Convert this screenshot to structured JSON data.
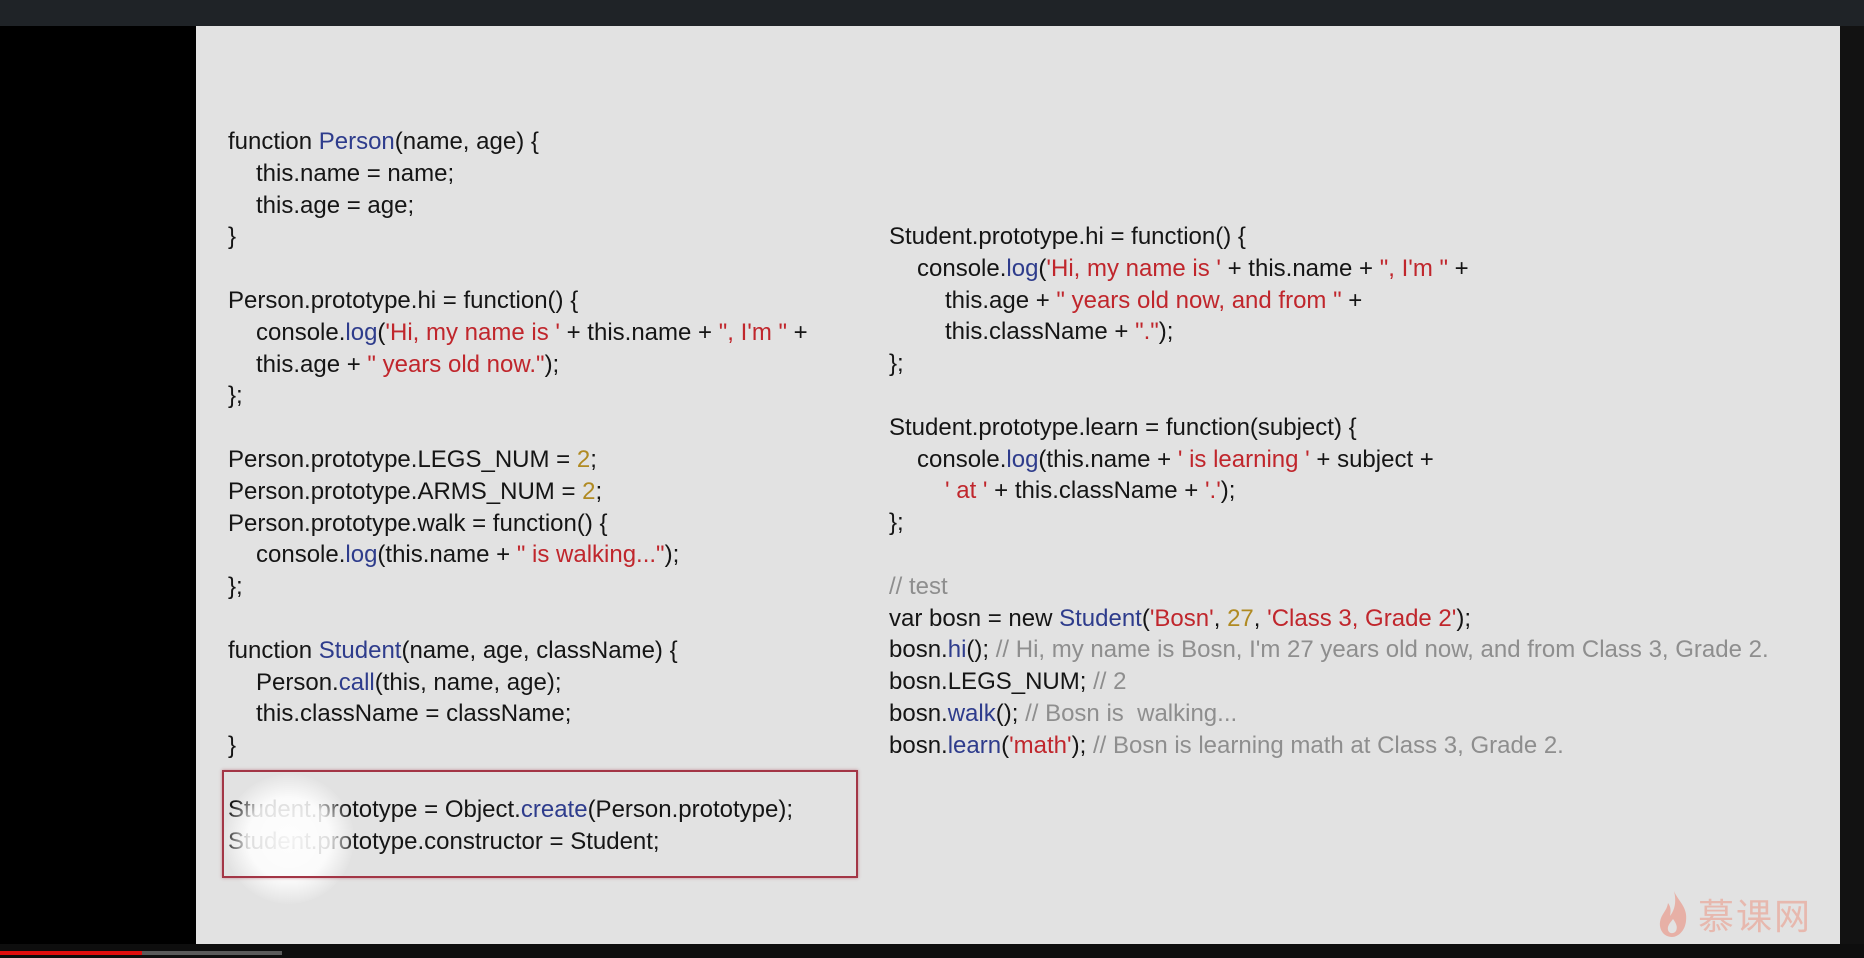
{
  "left_code": [
    {
      "indent": 0,
      "tokens": [
        {
          "t": "function ",
          "c": "t"
        },
        {
          "t": "Person",
          "c": "fn"
        },
        {
          "t": "(name, age) {",
          "c": "t"
        }
      ]
    },
    {
      "indent": 1,
      "tokens": [
        {
          "t": "this.name = name;",
          "c": "t"
        }
      ]
    },
    {
      "indent": 1,
      "tokens": [
        {
          "t": "this.age = age;",
          "c": "t"
        }
      ]
    },
    {
      "indent": 0,
      "tokens": [
        {
          "t": "}",
          "c": "t"
        }
      ]
    },
    {
      "indent": 0,
      "tokens": []
    },
    {
      "indent": 0,
      "tokens": [
        {
          "t": "Person.prototype.hi = function() {",
          "c": "t"
        }
      ]
    },
    {
      "indent": 1,
      "tokens": [
        {
          "t": "console.",
          "c": "t"
        },
        {
          "t": "log",
          "c": "fn"
        },
        {
          "t": "(",
          "c": "t"
        },
        {
          "t": "'Hi, my name is '",
          "c": "str"
        },
        {
          "t": " + this.name + ",
          "c": "t"
        },
        {
          "t": "\", I'm \"",
          "c": "str"
        },
        {
          "t": " +",
          "c": "t"
        }
      ]
    },
    {
      "indent": 1,
      "tokens": [
        {
          "t": "this.age + ",
          "c": "t"
        },
        {
          "t": "\" years old now.\"",
          "c": "str"
        },
        {
          "t": ");",
          "c": "t"
        }
      ]
    },
    {
      "indent": 0,
      "tokens": [
        {
          "t": "};",
          "c": "t"
        }
      ]
    },
    {
      "indent": 0,
      "tokens": []
    },
    {
      "indent": 0,
      "tokens": [
        {
          "t": "Person.prototype.LEGS_NUM = ",
          "c": "t"
        },
        {
          "t": "2",
          "c": "num"
        },
        {
          "t": ";",
          "c": "t"
        }
      ]
    },
    {
      "indent": 0,
      "tokens": [
        {
          "t": "Person.prototype.ARMS_NUM = ",
          "c": "t"
        },
        {
          "t": "2",
          "c": "num"
        },
        {
          "t": ";",
          "c": "t"
        }
      ]
    },
    {
      "indent": 0,
      "tokens": [
        {
          "t": "Person.prototype.walk = function() {",
          "c": "t"
        }
      ]
    },
    {
      "indent": 1,
      "tokens": [
        {
          "t": "console.",
          "c": "t"
        },
        {
          "t": "log",
          "c": "fn"
        },
        {
          "t": "(this.name + ",
          "c": "t"
        },
        {
          "t": "\" is walking...\"",
          "c": "str"
        },
        {
          "t": ");",
          "c": "t"
        }
      ]
    },
    {
      "indent": 0,
      "tokens": [
        {
          "t": "};",
          "c": "t"
        }
      ]
    },
    {
      "indent": 0,
      "tokens": []
    },
    {
      "indent": 0,
      "tokens": [
        {
          "t": "function ",
          "c": "t"
        },
        {
          "t": "Student",
          "c": "fn"
        },
        {
          "t": "(name, age, className) {",
          "c": "t"
        }
      ]
    },
    {
      "indent": 1,
      "tokens": [
        {
          "t": "Person.",
          "c": "t"
        },
        {
          "t": "call",
          "c": "fn"
        },
        {
          "t": "(this, name, age);",
          "c": "t"
        }
      ]
    },
    {
      "indent": 1,
      "tokens": [
        {
          "t": "this.className = className;",
          "c": "t"
        }
      ]
    },
    {
      "indent": 0,
      "tokens": [
        {
          "t": "}",
          "c": "t"
        }
      ]
    },
    {
      "indent": 0,
      "tokens": []
    },
    {
      "indent": 0,
      "tokens": [
        {
          "t": "Student.prototype = Object.",
          "c": "t"
        },
        {
          "t": "create",
          "c": "fn"
        },
        {
          "t": "(Person.prototype);",
          "c": "t"
        }
      ]
    },
    {
      "indent": 0,
      "tokens": [
        {
          "t": "Student.prototype.constructor = Student;",
          "c": "t"
        }
      ]
    }
  ],
  "right_code": [
    {
      "indent": 0,
      "tokens": [
        {
          "t": "Student.prototype.hi = function() {",
          "c": "t"
        }
      ]
    },
    {
      "indent": 1,
      "tokens": [
        {
          "t": "console.",
          "c": "t"
        },
        {
          "t": "log",
          "c": "fn"
        },
        {
          "t": "(",
          "c": "t"
        },
        {
          "t": "'Hi, my name is '",
          "c": "str"
        },
        {
          "t": " + this.name + ",
          "c": "t"
        },
        {
          "t": "\", I'm \"",
          "c": "str"
        },
        {
          "t": " +",
          "c": "t"
        }
      ]
    },
    {
      "indent": 2,
      "tokens": [
        {
          "t": "this.age + ",
          "c": "t"
        },
        {
          "t": "\" years old now, and from \"",
          "c": "str"
        },
        {
          "t": " +",
          "c": "t"
        }
      ]
    },
    {
      "indent": 2,
      "tokens": [
        {
          "t": "this.className + ",
          "c": "t"
        },
        {
          "t": "\".\"",
          "c": "str"
        },
        {
          "t": ");",
          "c": "t"
        }
      ]
    },
    {
      "indent": 0,
      "tokens": [
        {
          "t": "};",
          "c": "t"
        }
      ]
    },
    {
      "indent": 0,
      "tokens": []
    },
    {
      "indent": 0,
      "tokens": [
        {
          "t": "Student.prototype.learn = function(subject) {",
          "c": "t"
        }
      ]
    },
    {
      "indent": 1,
      "tokens": [
        {
          "t": "console.",
          "c": "t"
        },
        {
          "t": "log",
          "c": "fn"
        },
        {
          "t": "(this.name + ",
          "c": "t"
        },
        {
          "t": "' is learning '",
          "c": "str"
        },
        {
          "t": " + subject +",
          "c": "t"
        }
      ]
    },
    {
      "indent": 2,
      "tokens": [
        {
          "t": "' at '",
          "c": "str"
        },
        {
          "t": " + this.className + ",
          "c": "t"
        },
        {
          "t": "'.'",
          "c": "str"
        },
        {
          "t": ");",
          "c": "t"
        }
      ]
    },
    {
      "indent": 0,
      "tokens": [
        {
          "t": "};",
          "c": "t"
        }
      ]
    },
    {
      "indent": 0,
      "tokens": []
    },
    {
      "indent": 0,
      "tokens": [
        {
          "t": "// test",
          "c": "cmt"
        }
      ]
    },
    {
      "indent": 0,
      "tokens": [
        {
          "t": "var bosn = new ",
          "c": "t"
        },
        {
          "t": "Student",
          "c": "fn"
        },
        {
          "t": "(",
          "c": "t"
        },
        {
          "t": "'Bosn'",
          "c": "str"
        },
        {
          "t": ", ",
          "c": "t"
        },
        {
          "t": "27",
          "c": "num"
        },
        {
          "t": ", ",
          "c": "t"
        },
        {
          "t": "'Class 3, Grade 2'",
          "c": "str"
        },
        {
          "t": ");",
          "c": "t"
        }
      ]
    },
    {
      "indent": 0,
      "tokens": [
        {
          "t": "bosn.",
          "c": "t"
        },
        {
          "t": "hi",
          "c": "fn"
        },
        {
          "t": "(); ",
          "c": "t"
        },
        {
          "t": "// Hi, my name is Bosn, I'm 27 years old now, and from Class 3, Grade 2.",
          "c": "cmt"
        }
      ]
    },
    {
      "indent": 0,
      "tokens": [
        {
          "t": "bosn.LEGS_NUM; ",
          "c": "t"
        },
        {
          "t": "// 2",
          "c": "cmt"
        }
      ]
    },
    {
      "indent": 0,
      "tokens": [
        {
          "t": "bosn.",
          "c": "t"
        },
        {
          "t": "walk",
          "c": "fn"
        },
        {
          "t": "(); ",
          "c": "t"
        },
        {
          "t": "// Bosn is  walking...",
          "c": "cmt"
        }
      ]
    },
    {
      "indent": 0,
      "tokens": [
        {
          "t": "bosn.",
          "c": "t"
        },
        {
          "t": "learn",
          "c": "fn"
        },
        {
          "t": "(",
          "c": "t"
        },
        {
          "t": "'math'",
          "c": "str"
        },
        {
          "t": "); ",
          "c": "t"
        },
        {
          "t": "// Bosn is learning math at Class 3, Grade 2.",
          "c": "cmt"
        }
      ]
    }
  ],
  "logo": {
    "text": "慕课网"
  },
  "video": {
    "progress_fraction": 0.076,
    "buffered_fraction": 0.151
  },
  "colors": {
    "function_name": "#2e3c8c",
    "string": "#c0262c",
    "number": "#b08a22",
    "comment": "#8e8e8e",
    "highlight_border": "#a33646"
  }
}
